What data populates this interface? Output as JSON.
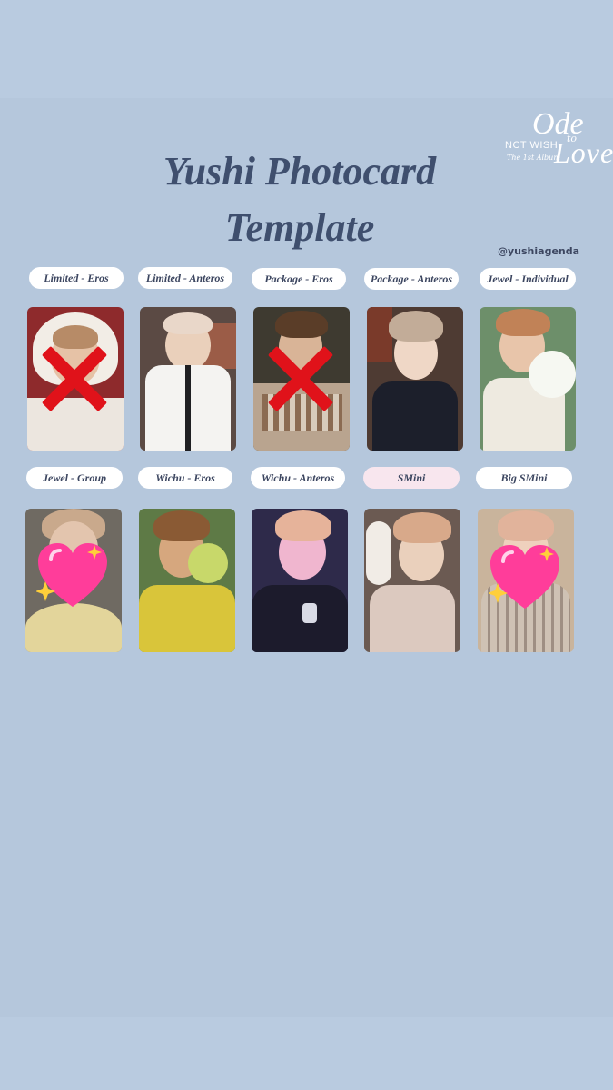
{
  "title": {
    "line1": "Yushi Photocard",
    "line2": "Template"
  },
  "logo": {
    "ode": "Ode",
    "to": "to",
    "love": "Love",
    "group": "NCT WISH",
    "sub": "The 1st Album"
  },
  "handle": "@yushiagenda",
  "row1": [
    {
      "label": "Limited - Eros",
      "status": "crossed"
    },
    {
      "label": "Limited - Anteros",
      "status": "none"
    },
    {
      "label": "Package - Eros",
      "status": "crossed"
    },
    {
      "label": "Package - Anteros",
      "status": "none"
    },
    {
      "label": "Jewel - Individual",
      "status": "none"
    }
  ],
  "row2": [
    {
      "label": "Jewel - Group",
      "status": "hearted"
    },
    {
      "label": "Wichu - Eros",
      "status": "none"
    },
    {
      "label": "Wichu - Anteros",
      "status": "none"
    },
    {
      "label": "SMini",
      "status": "none"
    },
    {
      "label": "Big SMini",
      "status": "hearted"
    }
  ],
  "colors": {
    "background": "#b5c7dc",
    "title": "#3f4f6e",
    "cross": "#e0121a",
    "heart": "#ff3d9a"
  },
  "icons": {
    "cross": "cross-mark-icon",
    "heart": "sparkling-heart-icon"
  }
}
